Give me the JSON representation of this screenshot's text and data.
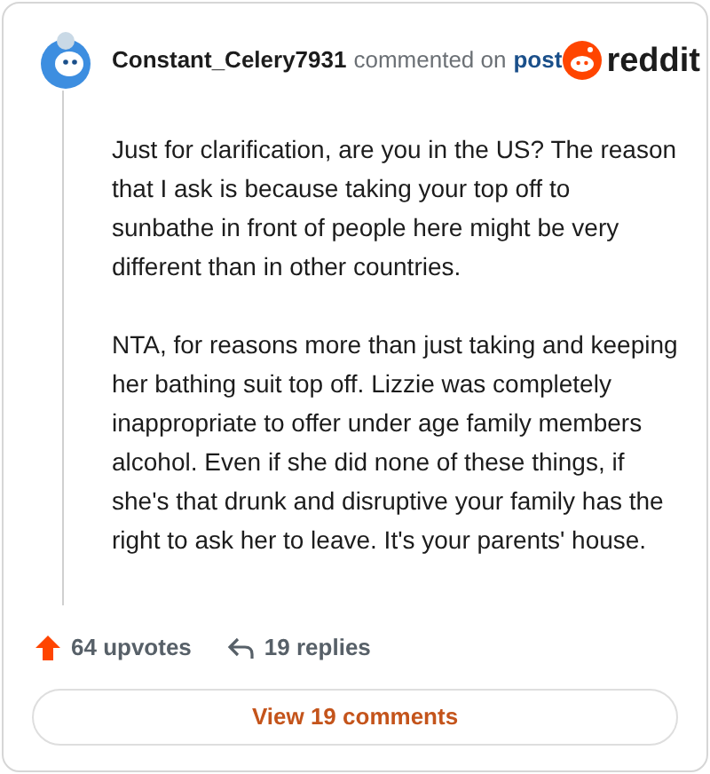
{
  "comment": {
    "author": "Constant_Celery7931",
    "action": "commented on",
    "link": "post",
    "brand": "reddit",
    "paragraphs": [
      "Just for clarification, are you in the US? The reason that I ask is because taking your top off to sunbathe in front of people here might be very different than in other countries.",
      "NTA, for reasons more than just taking and keeping her bathing suit top off. Lizzie was completely inappropriate to offer under age family members alcohol. Even if she did none of these things, if she's that drunk and disruptive your family has the right to ask her to leave. It's your parents' house."
    ]
  },
  "footer": {
    "upvotes": "64 upvotes",
    "replies": "19 replies"
  },
  "button": "View 19 comments"
}
